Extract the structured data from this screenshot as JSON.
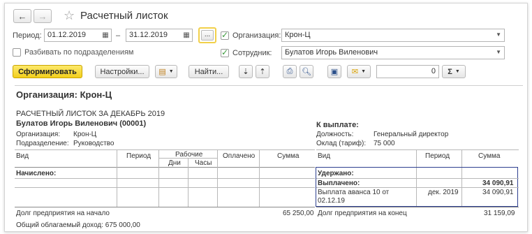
{
  "window": {
    "title": "Расчетный листок"
  },
  "nav": {
    "back_glyph": "←",
    "forward_glyph": "→"
  },
  "filters": {
    "period_label": "Период:",
    "date_from": "01.12.2019",
    "dash": "–",
    "date_to": "31.12.2019",
    "more_label": "...",
    "org_label": "Организация:",
    "org_value": "Крон-Ц",
    "split_label": "Разбивать по подразделениям",
    "employee_label": "Сотрудник:",
    "employee_value": "Булатов Игорь Виленович"
  },
  "toolbar": {
    "generate_label": "Сформировать",
    "settings_label": "Настройки...",
    "find_label": "Найти...",
    "number_value": "0",
    "sum_glyph": "Σ"
  },
  "report": {
    "org_heading": "Организация: Крон-Ц",
    "sheet_title": "РАСЧЕТНЫЙ ЛИСТОК ЗА ДЕКАБРЬ 2019",
    "employee_name": "Булатов Игорь Виленович (00001)",
    "org_key": "Организация:",
    "org_val": "Крон-Ц",
    "dept_key": "Подразделение:",
    "dept_val": "Руководство",
    "payout_title": "К выплате:",
    "position_key": "Должность:",
    "position_val": "Генеральный директор",
    "salary_key": "Оклад (тариф):",
    "salary_val": "75 000",
    "left_headers": {
      "vid": "Вид",
      "period": "Период",
      "work": "Рабочие",
      "days": "Дни",
      "hours": "Часы",
      "paid": "Оплачено",
      "sum": "Сумма"
    },
    "right_headers": {
      "vid": "Вид",
      "period": "Период",
      "sum": "Сумма"
    },
    "accrued_label": "Начислено:",
    "withheld_label": "Удержано:",
    "paid_out_label": "Выплачено:",
    "paid_out_total": "34 090,91",
    "advance_line1": "Выплата аванса 10 от",
    "advance_line2": "02.12.19",
    "advance_period": "дек. 2019",
    "advance_sum": "34 090,91",
    "debt_start_label": "Долг предприятия на начало",
    "debt_start_value": "65 250,00",
    "debt_end_label": "Долг предприятия на конец",
    "debt_end_value": "31 159,09",
    "taxable_income": "Общий облагаемый доход: 675 000,00"
  }
}
